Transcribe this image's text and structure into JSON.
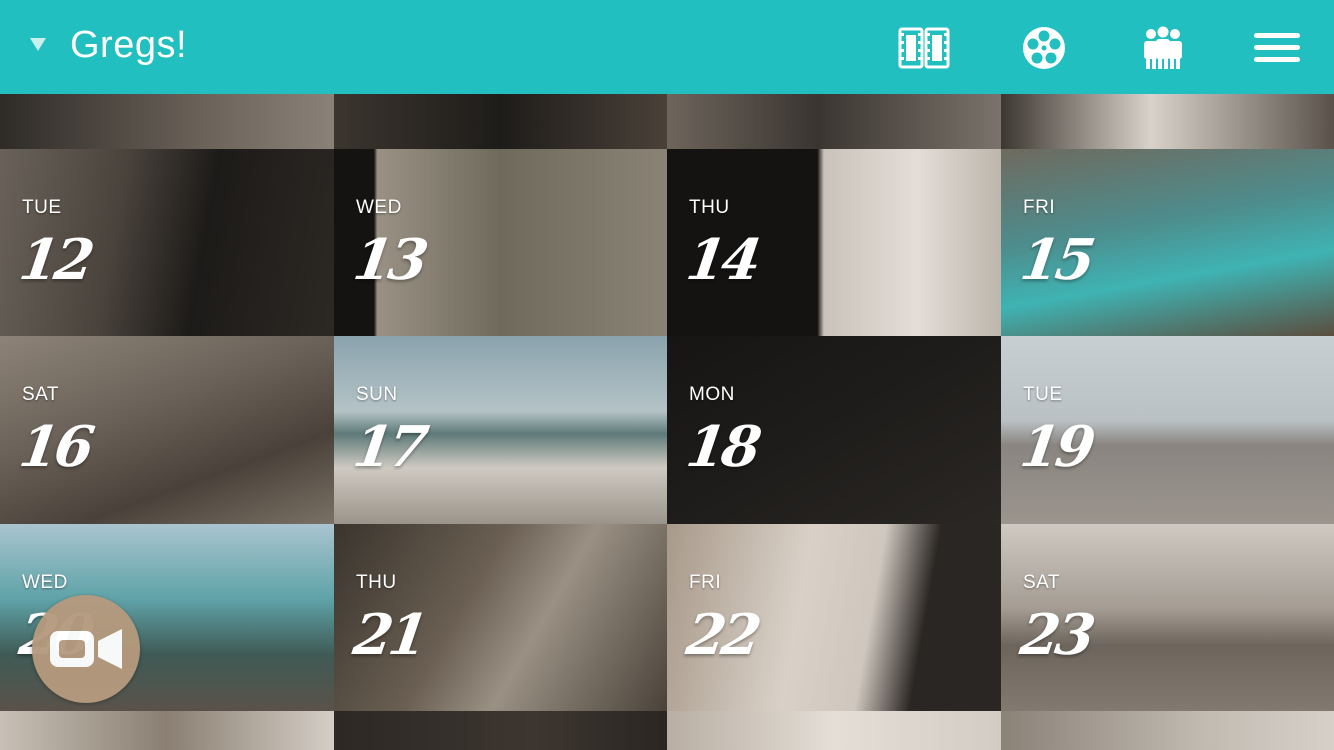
{
  "header": {
    "title": "Gregs!",
    "bg_color": "#21bfbf"
  },
  "icons": {
    "caret": "caret-down-icon",
    "film": "film-strip-icon",
    "reel": "film-reel-icon",
    "people": "group-icon",
    "menu": "hamburger-menu-icon",
    "record": "video-camera-icon"
  },
  "days": [
    {
      "dow": "TUE",
      "num": "12"
    },
    {
      "dow": "WED",
      "num": "13"
    },
    {
      "dow": "THU",
      "num": "14"
    },
    {
      "dow": "FRI",
      "num": "15"
    },
    {
      "dow": "SAT",
      "num": "16"
    },
    {
      "dow": "SUN",
      "num": "17"
    },
    {
      "dow": "MON",
      "num": "18"
    },
    {
      "dow": "TUE",
      "num": "19"
    },
    {
      "dow": "WED",
      "num": "20"
    },
    {
      "dow": "THU",
      "num": "21"
    },
    {
      "dow": "FRI",
      "num": "22"
    },
    {
      "dow": "SAT",
      "num": "23"
    }
  ]
}
